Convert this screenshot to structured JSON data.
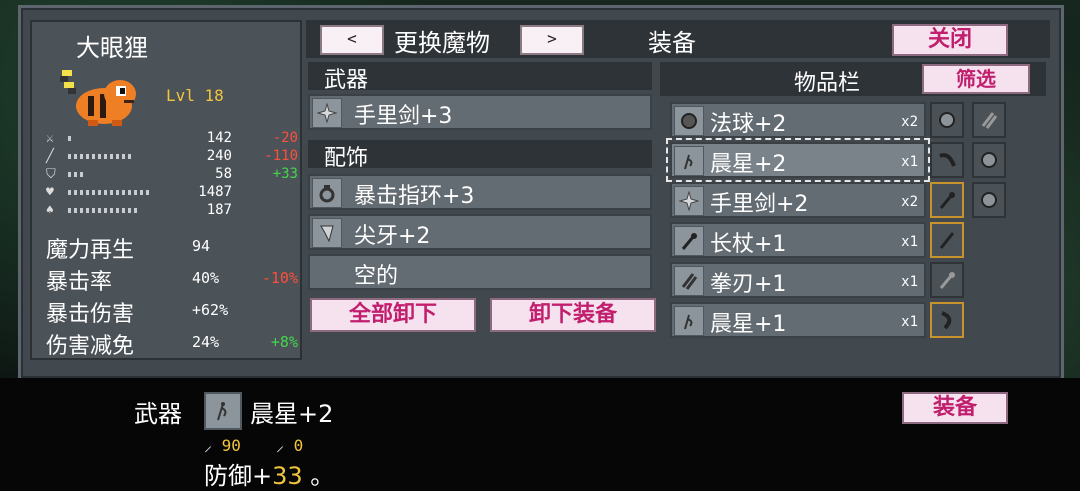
{
  "pet": {
    "name": "大眼狸",
    "level": "Lvl 18"
  },
  "stats": [
    {
      "icon": "sword-icon",
      "value": "142",
      "delta": "-20",
      "delta_color": "red",
      "bar": 0.05
    },
    {
      "icon": "staff-icon",
      "value": "240",
      "delta": "-110",
      "delta_color": "red",
      "bar": 0.7
    },
    {
      "icon": "shield-icon",
      "value": "58",
      "delta": "+33",
      "delta_color": "green",
      "bar": 0.2
    },
    {
      "icon": "heart-icon",
      "value": "1487",
      "delta": "",
      "delta_color": "",
      "bar": 0.9
    },
    {
      "icon": "potion-icon",
      "value": "187",
      "delta": "",
      "delta_color": "",
      "bar": 0.8
    }
  ],
  "bonus_stats": [
    {
      "label": "魔力再生",
      "value": "94",
      "delta": "",
      "delta_color": ""
    },
    {
      "label": "暴击率",
      "value": "40%",
      "delta": "-10%",
      "delta_color": "red"
    },
    {
      "label": "暴击伤害",
      "value": "+62%",
      "delta": "",
      "delta_color": ""
    },
    {
      "label": "伤害减免",
      "value": "24%",
      "delta": "+8%",
      "delta_color": "green"
    }
  ],
  "header": {
    "prev": "<",
    "change_monster": "更换魔物",
    "next": ">",
    "title": "装备",
    "close": "关闭"
  },
  "equip": {
    "weapon_header": "武器",
    "weapon": "手里剑+3",
    "accessory_header": "配饰",
    "acc1": "暴击指环+3",
    "acc2": "尖牙+2",
    "acc3": "空的",
    "unequip_all": "全部卸下",
    "unequip": "卸下装备"
  },
  "inventory": {
    "title": "物品栏",
    "filter": "筛选",
    "items": [
      {
        "name": "法球+2",
        "qty": "x2",
        "icon": "orb-icon"
      },
      {
        "name": "晨星+2",
        "qty": "x1",
        "icon": "morningstar-icon",
        "selected": true
      },
      {
        "name": "手里剑+2",
        "qty": "x2",
        "icon": "shuriken-icon"
      },
      {
        "name": "长杖+1",
        "qty": "x1",
        "icon": "staff-icon"
      },
      {
        "name": "拳刃+1",
        "qty": "x1",
        "icon": "claw-icon"
      },
      {
        "name": "晨星+1",
        "qty": "x1",
        "icon": "morningstar-icon"
      }
    ]
  },
  "bottom": {
    "type": "武器",
    "item_name": "晨星+2",
    "atk": "90",
    "mag": "0",
    "desc_prefix": "防御+",
    "desc_value": "33",
    "desc_suffix": " 。",
    "equip_button": "装备"
  },
  "colors": {
    "gold": "#f2c53d",
    "pink_text": "#c11f6e",
    "red": "#ff4e3a",
    "green": "#45d64b"
  }
}
